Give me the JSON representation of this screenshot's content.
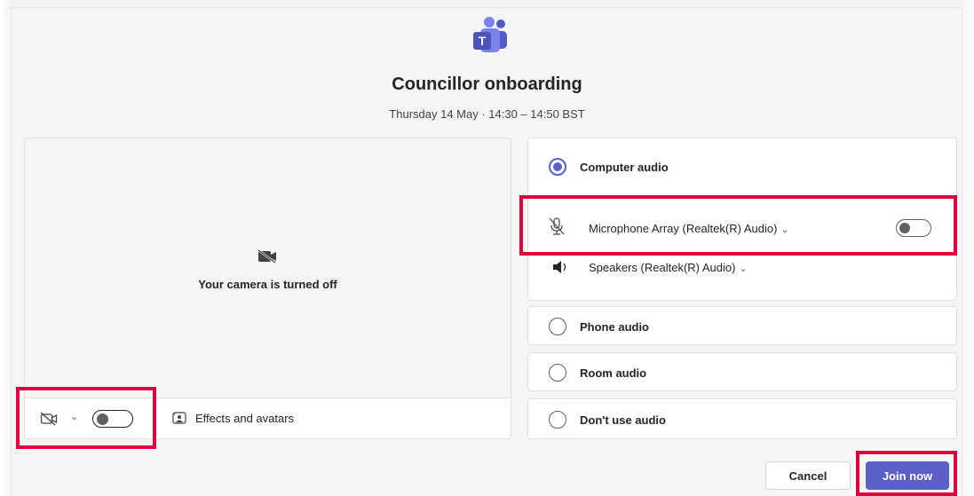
{
  "meeting": {
    "title": "Councillor onboarding",
    "time": "Thursday 14 May · 14:30 – 14:50 BST"
  },
  "video": {
    "camera_status": "Your camera is turned off",
    "camera_toggle_on": false,
    "effects_label": "Effects and avatars"
  },
  "audio": {
    "options": [
      {
        "label": "Computer audio",
        "selected": true
      },
      {
        "label": "Phone audio",
        "selected": false
      },
      {
        "label": "Room audio",
        "selected": false
      },
      {
        "label": "Don't use audio",
        "selected": false
      }
    ],
    "microphone": {
      "label": "Microphone Array (Realtek(R) Audio)",
      "enabled": false
    },
    "speakers": {
      "label": "Speakers (Realtek(R) Audio)"
    }
  },
  "actions": {
    "cancel_label": "Cancel",
    "join_label": "Join now"
  },
  "colors": {
    "accent": "#5b5fc7",
    "highlight": "#e1003c"
  },
  "icons": {
    "logo": "teams-logo-icon",
    "camera_off": "camera-off-icon",
    "mic_off": "mic-off-icon",
    "speaker": "speaker-icon",
    "effects": "effects-icon"
  }
}
